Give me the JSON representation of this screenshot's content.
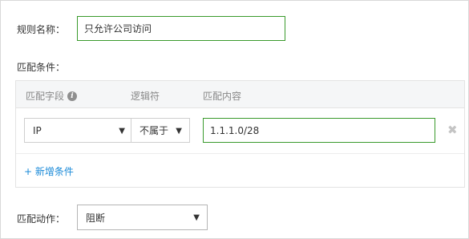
{
  "rule_name": {
    "label": "规则名称：",
    "value": "只允许公司访问"
  },
  "conditions": {
    "label": "匹配条件：",
    "headers": {
      "field": "匹配字段",
      "logic": "逻辑符",
      "content": "匹配内容"
    },
    "row": {
      "field": "IP",
      "logic": "不属于",
      "content": "1.1.1.0/28"
    },
    "add_label": "+ 新增条件"
  },
  "action": {
    "label": "匹配动作：",
    "value": "阻断"
  },
  "icons": {
    "info": "info-icon",
    "remove": "close-icon",
    "caret": "caret-down-icon"
  },
  "colors": {
    "focus_border": "#3a9a2c",
    "link": "#1a8ad8",
    "header_bg": "#f5f6f7"
  }
}
